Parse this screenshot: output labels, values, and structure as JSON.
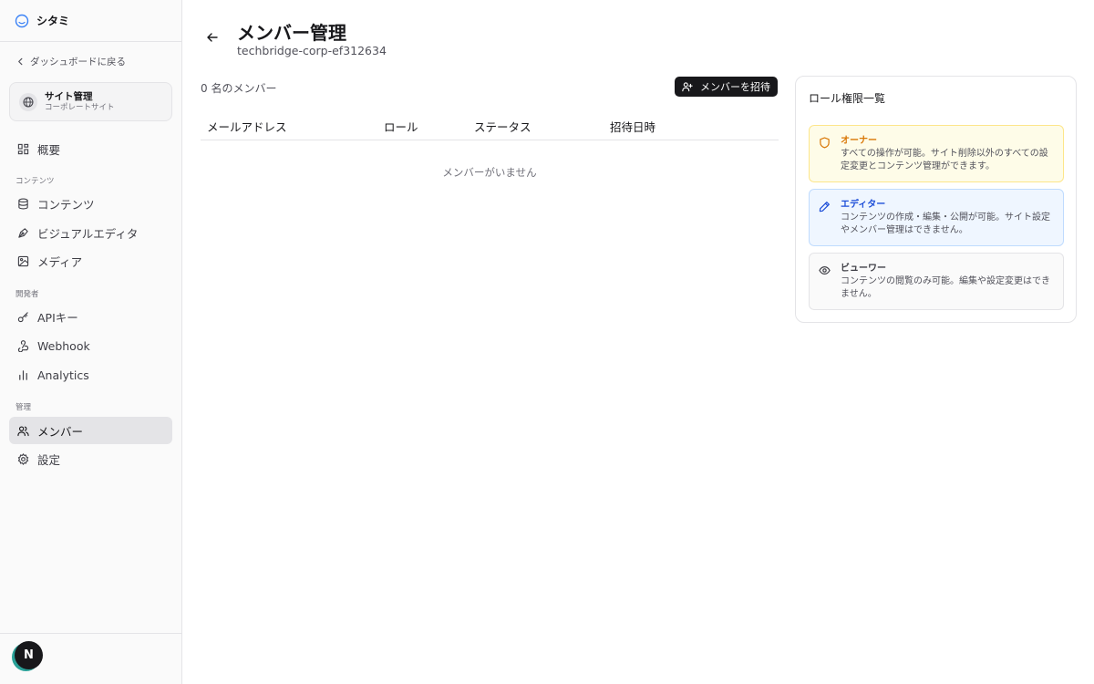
{
  "brand": {
    "name": "シタミ"
  },
  "sidebar": {
    "back_label": "ダッシュボードに戻る",
    "site": {
      "title": "サイト管理",
      "subtitle": "コーポレートサイト"
    },
    "overview_label": "概要",
    "sections": {
      "content": "コンテンツ",
      "developer": "開発者",
      "management": "管理"
    },
    "items": {
      "contents": "コンテンツ",
      "visual_editor": "ビジュアルエディタ",
      "media": "メディア",
      "api_keys": "APIキー",
      "webhook": "Webhook",
      "analytics": "Analytics",
      "members": "メンバー",
      "settings": "設定"
    },
    "active_item": "members",
    "avatar_letter": "N"
  },
  "page": {
    "title": "メンバー管理",
    "subtitle": "techbridge-corp-ef312634",
    "member_count": "0 名のメンバー",
    "invite_label": "メンバーを招待"
  },
  "table": {
    "columns": [
      "メールアドレス",
      "ロール",
      "ステータス",
      "招待日時"
    ],
    "rows": [],
    "empty_message": "メンバーがいません"
  },
  "roles": {
    "title": "ロール権限一覧",
    "items": [
      {
        "name": "オーナー",
        "description": "すべての操作が可能。サイト削除以外のすべての設定変更とコンテンツ管理ができます。",
        "icon": "shield-icon",
        "color": "#d97706",
        "bg": "#fefce8",
        "border": "#fde68a"
      },
      {
        "name": "エディター",
        "description": "コンテンツの作成・編集・公開が可能。サイト設定やメンバー管理はできません。",
        "icon": "pencil-icon",
        "color": "#1d4ed8",
        "bg": "#eff6ff",
        "border": "#bfdbfe"
      },
      {
        "name": "ビューワー",
        "description": "コンテンツの閲覧のみ可能。編集や設定変更はできません。",
        "icon": "eye-icon",
        "color": "#3f3f46",
        "bg": "#fafafa",
        "border": "#e4e4e7"
      }
    ]
  }
}
